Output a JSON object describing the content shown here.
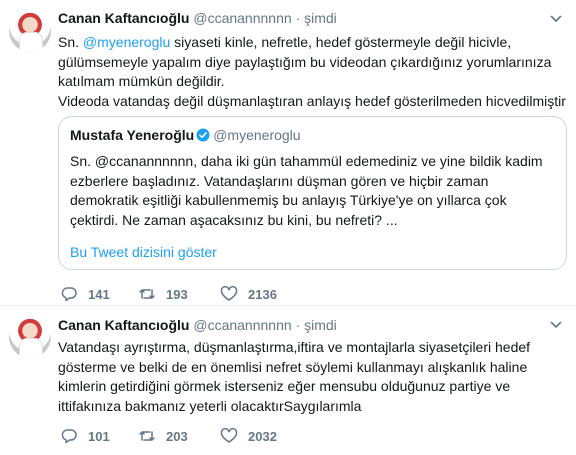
{
  "tweets": [
    {
      "author_name": "Canan Kaftancıoğlu",
      "author_handle": "@ccanannnnnn",
      "separator": "·",
      "time": "şimdi",
      "text_before": "Sn. ",
      "mention": "@myeneroglu",
      "text_after": " siyaseti kinle, nefretle, hedef göstermeyle değil hicivle, gülümsemeyle yapalım diye paylaştığım bu videodan çıkardığınız yorumlarınıza katılmam mümkün değildir.",
      "text_line2": "Videoda vatandaş değil düşmanlaştıran anlayış hedef gösterilmeden hicvedilmiştir",
      "quote": {
        "author_name": "Mustafa Yeneroğlu",
        "author_handle": "@myeneroglu",
        "text": "Sn. @ccanannnnnn, daha iki gün tahammül edemediniz ve yine  bildik kadim ezberlere başladınız. Vatandaşlarını düşman gören ve hiçbir zaman demokratik eşitliği kabullenmemiş bu anlayış Türkiye'ye on yıllarca çok çektirdi. Ne zaman aşacaksınız bu kini, bu nefreti? ...",
        "show_thread": "Bu Tweet dizisini göster"
      },
      "replies": "141",
      "retweets": "193",
      "likes": "2136"
    },
    {
      "author_name": "Canan Kaftancıoğlu",
      "author_handle": "@ccanannnnnn",
      "separator": "·",
      "time": "şimdi",
      "text": "Vatandaşı ayrıştırma, düşmanlaştırma,iftira ve montajlarla siyasetçileri hedef gösterme ve belki de en önemlisi nefret söylemi kullanmayı alışkanlık haline kimlerin getirdiğini görmek isterseniz eğer mensubu olduğunuz partiye ve ittifakınıza bakmanız yeterli olacaktırSaygılarımla",
      "replies": "101",
      "retweets": "203",
      "likes": "2032"
    }
  ],
  "icons": {
    "reply": "reply-icon",
    "retweet": "retweet-icon",
    "like": "heart-icon",
    "more": "chevron-down-icon",
    "verified": "verified-badge-icon"
  },
  "colors": {
    "link": "#1da1f2",
    "secondary": "#657786",
    "border": "#ccd6dd",
    "text": "#14171a"
  }
}
